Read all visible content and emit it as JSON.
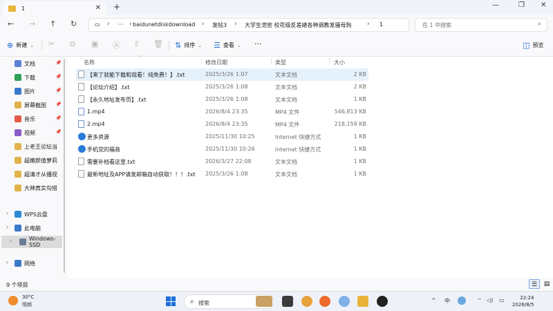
{
  "titlebar": {
    "tab_title": "1",
    "close_glyph": "✕",
    "new_tab_glyph": "+",
    "minimize_glyph": "—",
    "maximize_glyph": "❐",
    "window_close_glyph": "✕"
  },
  "nav": {
    "back_glyph": "←",
    "forward_glyph": "→",
    "up_glyph": "↑",
    "refresh_glyph": "↻",
    "view_glyph": "▭",
    "separator_glyph": "›",
    "more_glyph": "···"
  },
  "breadcrumb": [
    "baidunetdiskdownload",
    "发帖3",
    "大学生泄密 校花级反差婊各种调教发骚母狗",
    "1"
  ],
  "search": {
    "placeholder": "在 1 中搜索",
    "icon": "search-icon",
    "glyph": "⌕"
  },
  "toolbar": {
    "new_label": "新建",
    "new_glyph": "⊕",
    "sort_label": "排序",
    "sort_glyph": "⇅",
    "view_label": "查看",
    "view_glyph": "☰",
    "more_glyph": "···",
    "preview_label": "预览",
    "preview_glyph": "◫",
    "caret_glyph": "⌄",
    "cut_glyph": "✂",
    "copy_glyph": "⧉",
    "paste_glyph": "▣",
    "rename_glyph": "Ⓐ",
    "share_glyph": "⇪",
    "delete_glyph": "🗑"
  },
  "sidebar": {
    "pin_glyph": "📌",
    "chevron_glyph": "›",
    "quick_access": [
      {
        "label": "文档",
        "color": "#5a7fd6"
      },
      {
        "label": "下载",
        "color": "#2f9e58"
      },
      {
        "label": "图片",
        "color": "#3a78c9"
      },
      {
        "label": "屏幕截图",
        "color": "#e2b34a"
      },
      {
        "label": "音乐",
        "color": "#e45a4a"
      },
      {
        "label": "视频",
        "color": "#8b5cc9"
      },
      {
        "label": "上老王论坛当",
        "color": "#e2b34a"
      },
      {
        "label": "超嫩颜值萝莉",
        "color": "#e2b34a"
      },
      {
        "label": "超清才从播视",
        "color": "#e2b34a"
      },
      {
        "label": "大神真实勾搭",
        "color": "#e2b34a"
      }
    ],
    "wps": "WPS云盘",
    "this_pc": "此电脑",
    "drive": "Windows-SSD",
    "network": "网络"
  },
  "columns": {
    "name": "名称",
    "modified": "修改日期",
    "type": "类型",
    "size": "大小",
    "sort_glyph": "⌃"
  },
  "files": [
    {
      "name": "【来了就能下载和观看！纯免费！】.txt",
      "modified": "2025/3/26 1:07",
      "type": "文本文档",
      "size": "2 KB",
      "icon": "txt-icon"
    },
    {
      "name": "【论坛介绍】.txt",
      "modified": "2025/3/26 1:08",
      "type": "文本文档",
      "size": "2 KB",
      "icon": "txt-icon"
    },
    {
      "name": "【永久地址发布页】.txt",
      "modified": "2025/3/26 1:08",
      "type": "文本文档",
      "size": "1 KB",
      "icon": "txt-icon"
    },
    {
      "name": "1.mp4",
      "modified": "2026/8/4 23:35",
      "type": "MP4 文件",
      "size": "546,813 KB",
      "icon": "mp4-icon"
    },
    {
      "name": "2.mp4",
      "modified": "2026/8/4 23:35",
      "type": "MP4 文件",
      "size": "218,159 KB",
      "icon": "mp4-icon"
    },
    {
      "name": "更多资源",
      "modified": "2025/11/30 10:25",
      "type": "Internet 快捷方式",
      "size": "1 KB",
      "icon": "url-icon"
    },
    {
      "name": "手机党的福音",
      "modified": "2025/11/30 10:26",
      "type": "Internet 快捷方式",
      "size": "1 KB",
      "icon": "url-icon"
    },
    {
      "name": "需要补档看这里.txt",
      "modified": "2026/3/27 22:08",
      "type": "文本文档",
      "size": "1 KB",
      "icon": "txt-icon"
    },
    {
      "name": "最新地址及APP请发邮箱自动获取！！！.txt",
      "modified": "2025/3/26 1:08",
      "type": "文本文档",
      "size": "1 KB",
      "icon": "txt-icon"
    }
  ],
  "status": {
    "item_count": "9 个项目",
    "details_view_glyph": "☰",
    "tiles_view_glyph": "▤"
  },
  "taskbar": {
    "temperature": "30°C",
    "weather": "晴朗",
    "search_label": "搜索",
    "search_glyph": "⌕",
    "tray_caret": "^",
    "ime": "中",
    "wifi_glyph": "⌔",
    "volume_glyph": "◁)",
    "battery_glyph": "▭",
    "time": "22:24",
    "date": "2026/8/5"
  }
}
